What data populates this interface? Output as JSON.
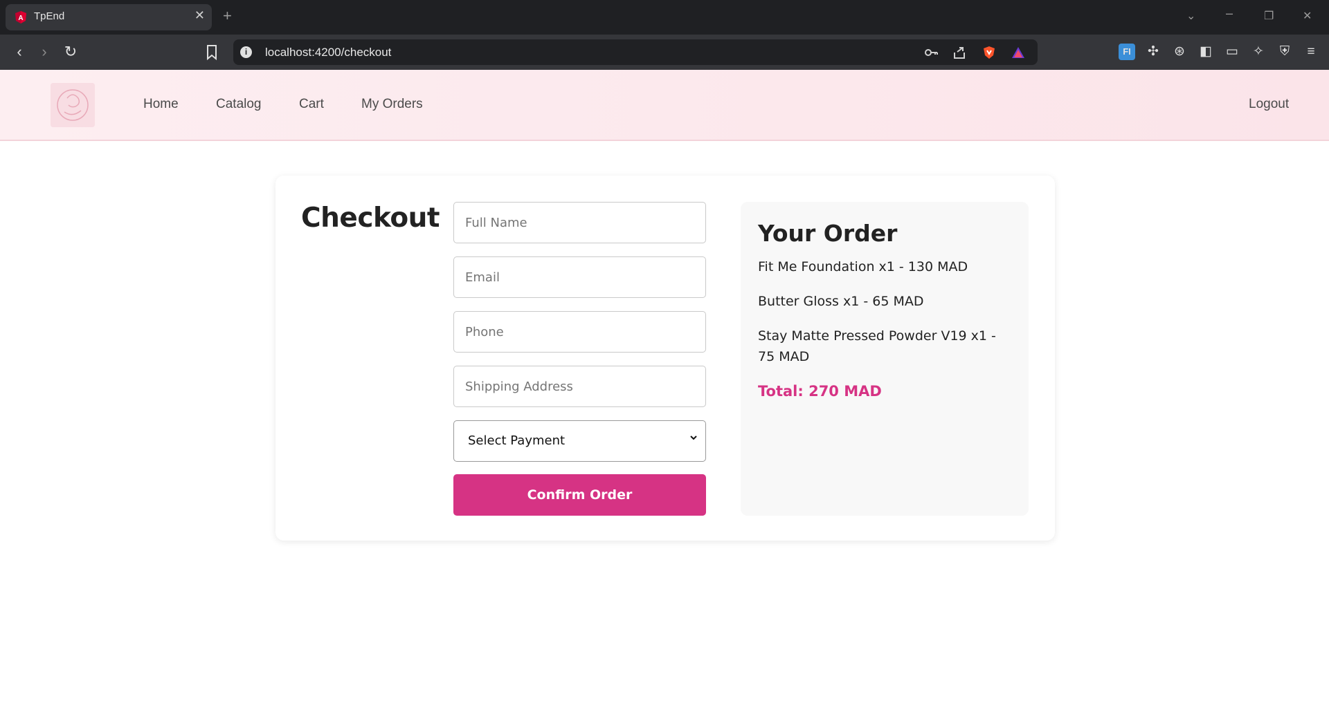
{
  "browser": {
    "tab_title": "TpEnd",
    "url": "localhost:4200/checkout"
  },
  "app": {
    "nav": {
      "home": "Home",
      "catalog": "Catalog",
      "cart": "Cart",
      "my_orders": "My Orders",
      "logout": "Logout"
    }
  },
  "checkout": {
    "title": "Checkout",
    "fields": {
      "full_name_placeholder": "Full Name",
      "email_placeholder": "Email",
      "phone_placeholder": "Phone",
      "address_placeholder": "Shipping Address",
      "payment_selected": "Select Payment"
    },
    "confirm_label": "Confirm Order"
  },
  "order_summary": {
    "title": "Your Order",
    "items": [
      "Fit Me Foundation x1 - 130 MAD",
      "Butter Gloss x1 - 65 MAD",
      "Stay Matte Pressed Powder V19 x1 - 75 MAD"
    ],
    "total": "Total: 270 MAD"
  },
  "colors": {
    "accent": "#d63384",
    "header_bg": "#fdeef1"
  }
}
